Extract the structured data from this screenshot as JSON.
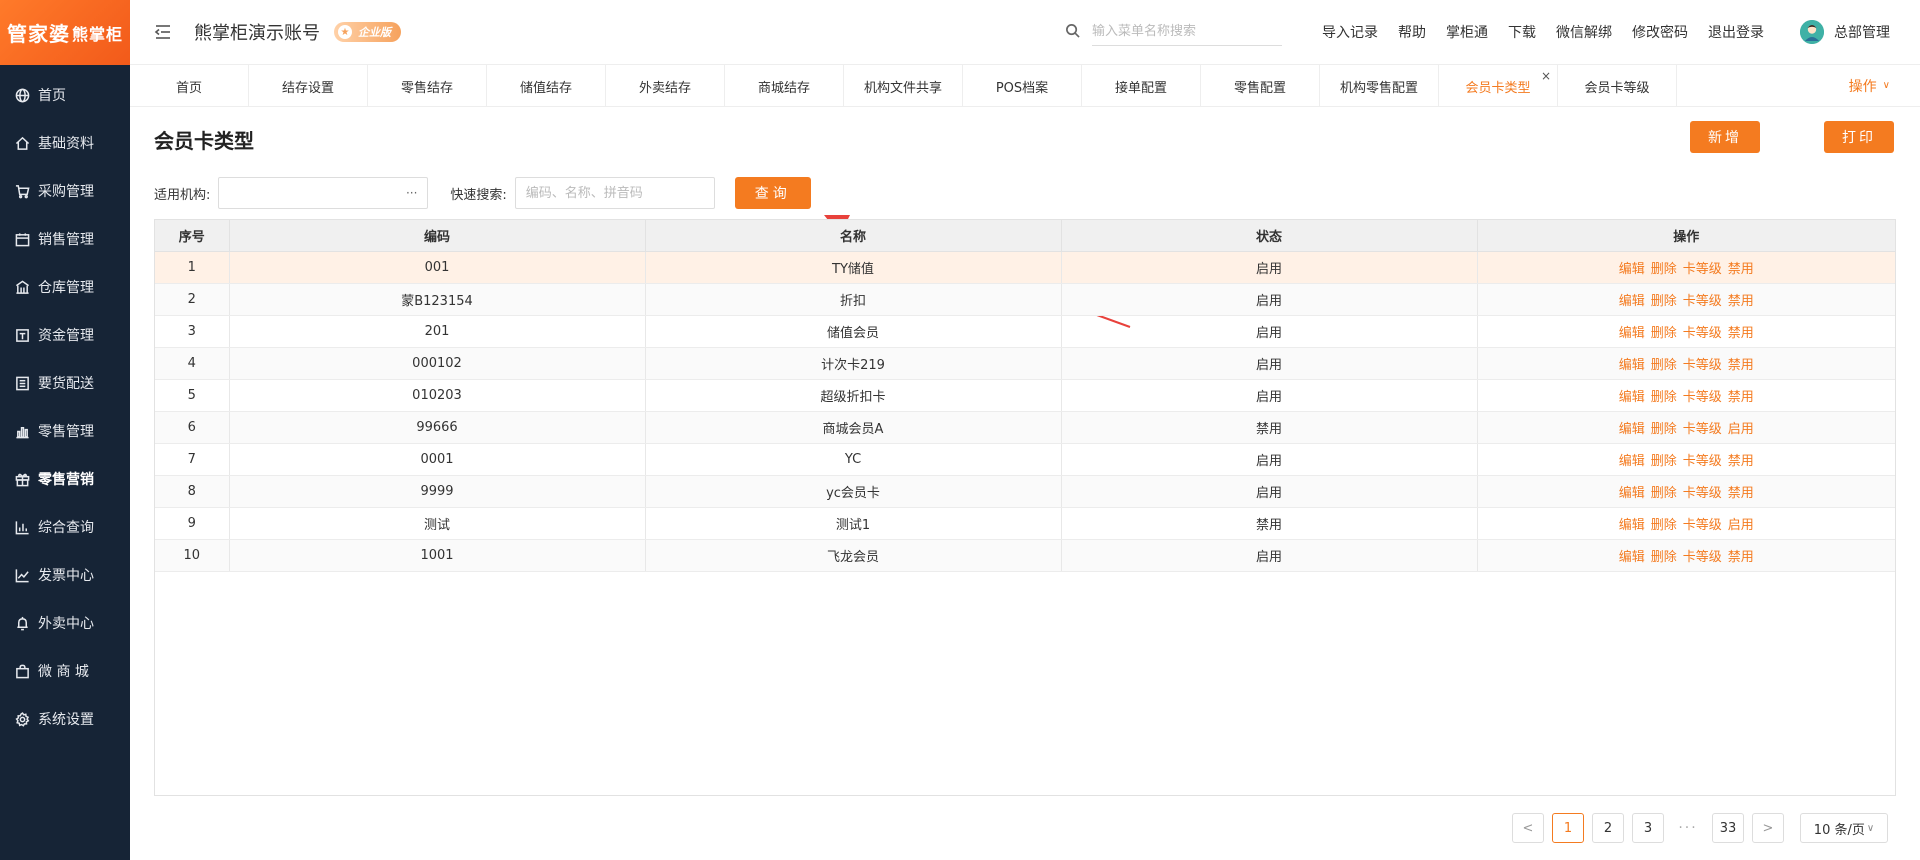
{
  "logo": {
    "main": "管家婆",
    "sub": "熊掌柜"
  },
  "sidebar": {
    "items": [
      {
        "label": "首页",
        "icon": "globe-icon"
      },
      {
        "label": "基础资料",
        "icon": "home-icon"
      },
      {
        "label": "采购管理",
        "icon": "cart-icon"
      },
      {
        "label": "销售管理",
        "icon": "calendar-icon"
      },
      {
        "label": "仓库管理",
        "icon": "warehouse-icon"
      },
      {
        "label": "资金管理",
        "icon": "wallet-icon"
      },
      {
        "label": "要货配送",
        "icon": "list-icon"
      },
      {
        "label": "零售管理",
        "icon": "bar-chart-icon"
      },
      {
        "label": "零售营销",
        "icon": "gift-icon",
        "active": true
      },
      {
        "label": "综合查询",
        "icon": "chart-icon"
      },
      {
        "label": "发票中心",
        "icon": "trend-icon"
      },
      {
        "label": "外卖中心",
        "icon": "bell-icon"
      },
      {
        "label": "微 商 城",
        "icon": "bag-icon"
      },
      {
        "label": "系统设置",
        "icon": "gear-icon"
      }
    ]
  },
  "header": {
    "account": "熊掌柜演示账号",
    "edition": "企业版",
    "search_placeholder": "输入菜单名称搜索",
    "links": [
      "导入记录",
      "帮助",
      "掌柜通",
      "下载",
      "微信解绑",
      "修改密码",
      "退出登录"
    ],
    "user": "总部管理"
  },
  "tabs": {
    "items": [
      "首页",
      "结存设置",
      "零售结存",
      "储值结存",
      "外卖结存",
      "商城结存",
      "机构文件共享",
      "POS档案",
      "接单配置",
      "零售配置",
      "机构零售配置",
      "会员卡类型",
      "会员卡等级"
    ],
    "active_index": 11,
    "close_symbol": "×",
    "ops_label": "操作",
    "ops_chevron": "∨"
  },
  "page": {
    "title": "会员卡类型",
    "new_label": "新增",
    "print_label": "打印",
    "org_label": "适用机构:",
    "org_dots": "···",
    "quick_label": "快速搜索:",
    "quick_placeholder": "编码、名称、拼音码",
    "query_label": "查询"
  },
  "table": {
    "columns": [
      "序号",
      "编码",
      "名称",
      "状态",
      "操作"
    ],
    "ops": {
      "edit": "编辑",
      "delete": "删除",
      "level": "卡等级"
    },
    "rows": [
      {
        "no": "1",
        "code": "001",
        "name": "TY储值",
        "status": "启用",
        "toggle": "禁用"
      },
      {
        "no": "2",
        "code": "蒙B123154",
        "name": "折扣",
        "status": "启用",
        "toggle": "禁用"
      },
      {
        "no": "3",
        "code": "201",
        "name": "储值会员",
        "status": "启用",
        "toggle": "禁用"
      },
      {
        "no": "4",
        "code": "000102",
        "name": "计次卡219",
        "status": "启用",
        "toggle": "禁用"
      },
      {
        "no": "5",
        "code": "010203",
        "name": "超级折扣卡",
        "status": "启用",
        "toggle": "禁用"
      },
      {
        "no": "6",
        "code": "99666",
        "name": "商城会员A",
        "status": "禁用",
        "toggle": "启用"
      },
      {
        "no": "7",
        "code": "0001",
        "name": "YC",
        "status": "启用",
        "toggle": "禁用"
      },
      {
        "no": "8",
        "code": "9999",
        "name": "yc会员卡",
        "status": "启用",
        "toggle": "禁用"
      },
      {
        "no": "9",
        "code": "测试",
        "name": "测试1",
        "status": "禁用",
        "toggle": "启用"
      },
      {
        "no": "10",
        "code": "1001",
        "name": "飞龙会员",
        "status": "启用",
        "toggle": "禁用"
      }
    ]
  },
  "pagination": {
    "prev": "<",
    "next": ">",
    "pages": [
      "1",
      "2",
      "3"
    ],
    "ellipsis": "···",
    "last": "33",
    "current": "1",
    "page_size": "10 条/页",
    "size_chevron": "∨"
  },
  "colors": {
    "accent": "#f47b20",
    "sidebar_bg": "#162436",
    "annotation_arrow": "#e8413b"
  }
}
